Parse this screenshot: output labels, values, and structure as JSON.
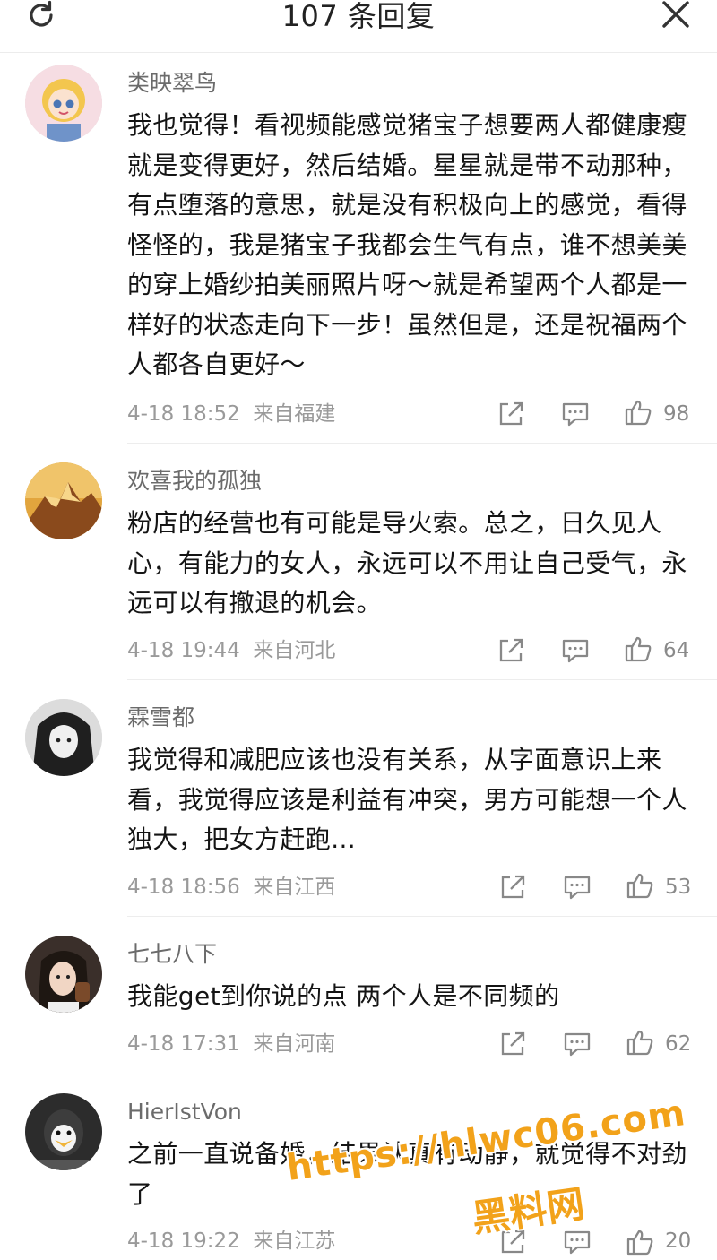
{
  "header": {
    "title": "107 条回复",
    "refresh_icon": "refresh-icon",
    "close_icon": "close-icon"
  },
  "comments": [
    {
      "username": "类映翠鸟",
      "text": "我也觉得！看视频能感觉猪宝子想要两人都健康瘦就是变得更好，然后结婚。星星就是带不动那种，有点堕落的意思，就是没有积极向上的感觉，看得怪怪的，我是猪宝子我都会生气有点，谁不想美美的穿上婚纱拍美丽照片呀～就是希望两个人都是一样好的状态走向下一步！虽然但是，还是祝福两个人都各自更好～",
      "time": "4-18 18:52",
      "location": "来自福建",
      "likes": "98"
    },
    {
      "username": "欢喜我的孤独",
      "text": "粉店的经营也有可能是导火索。总之，日久见人心，有能力的女人，永远可以不用让自己受气，永远可以有撤退的机会。",
      "time": "4-18 19:44",
      "location": "来自河北",
      "likes": "64"
    },
    {
      "username": "霖雪都",
      "text": "我觉得和减肥应该也没有关系，从字面意识上来看，我觉得应该是利益有冲突，男方可能想一个人独大，把女方赶跑...",
      "time": "4-18 18:56",
      "location": "来自江西",
      "likes": "53"
    },
    {
      "username": "七七八下",
      "text": "我能get到你说的点 两个人是不同频的",
      "time": "4-18 17:31",
      "location": "来自河南",
      "likes": "62"
    },
    {
      "username": "HierIstVon",
      "text": "之前一直说备婚，结果认真有动静，就觉得不对劲了",
      "time": "4-18 19:22",
      "location": "来自江苏",
      "likes": "20"
    }
  ],
  "icons": {
    "share": "share-icon",
    "comment": "comment-icon",
    "like": "like-icon"
  },
  "watermark": {
    "url": "https://hlwc06.com",
    "brand": "黑料网"
  },
  "colors": {
    "watermark": "#f2a21a",
    "text": "#141414",
    "meta": "#9a9a9a"
  }
}
